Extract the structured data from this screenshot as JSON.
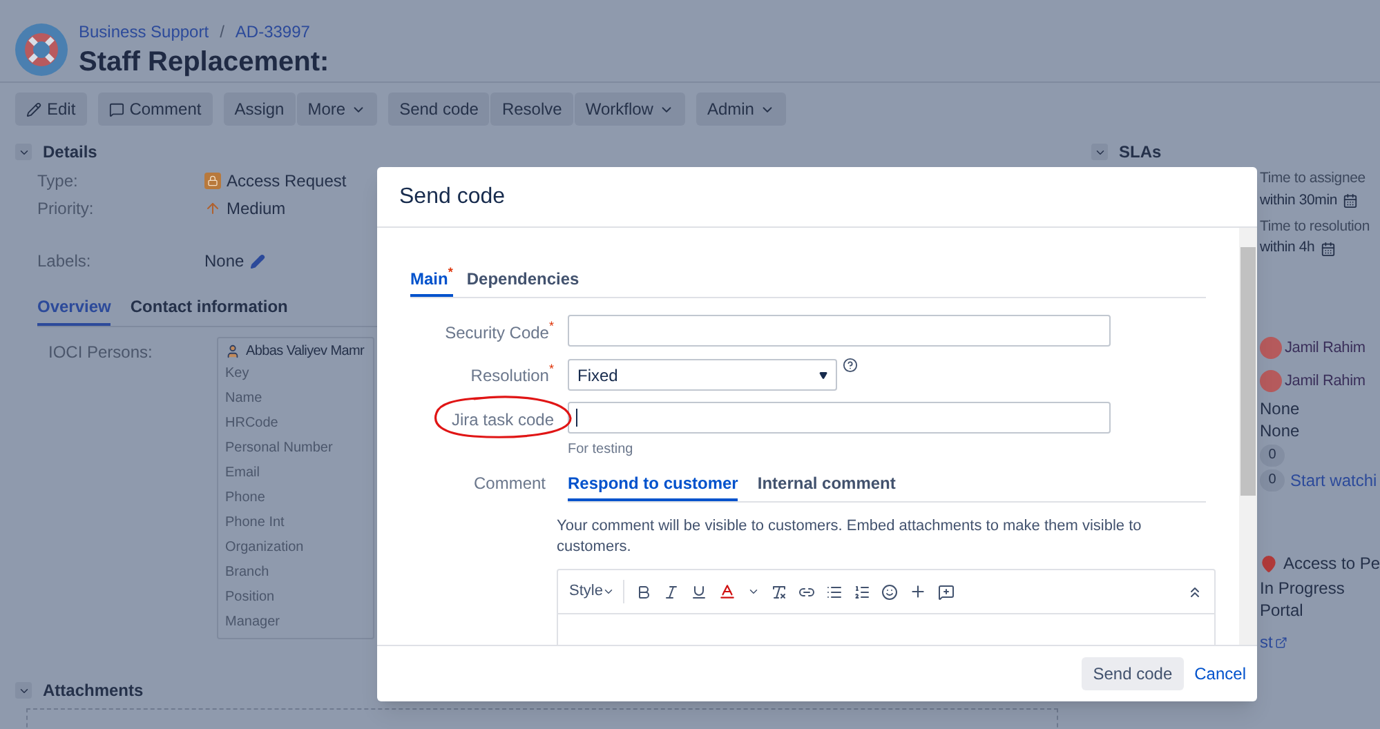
{
  "breadcrumb": {
    "project": "Business Support",
    "separator": "/",
    "key": "AD-33997"
  },
  "title": "Staff Replacement:",
  "toolbar": [
    [
      {
        "label": "Edit",
        "dropdown": false
      }
    ],
    [
      {
        "label": "Comment",
        "dropdown": false
      }
    ],
    [
      {
        "label": "Assign",
        "dropdown": false
      },
      {
        "label": "More",
        "dropdown": true
      }
    ],
    [
      {
        "label": "Send code",
        "dropdown": false
      },
      {
        "label": "Resolve",
        "dropdown": false
      },
      {
        "label": "Workflow",
        "dropdown": true
      }
    ],
    [
      {
        "label": "Admin",
        "dropdown": true
      }
    ]
  ],
  "details": {
    "heading": "Details",
    "expanded": true,
    "fields": [
      {
        "label": "Type:",
        "value": "Access Request"
      },
      {
        "label": "Priority:",
        "value": "Medium"
      },
      {
        "label": "Labels:",
        "value": "None"
      }
    ]
  },
  "detail_tabs": [
    {
      "label": "Overview",
      "selected": true
    },
    {
      "label": "Contact information",
      "selected": false
    }
  ],
  "persons": {
    "label": "IOCI Persons:",
    "name": "Abbas Valiyev Mamr",
    "fields": [
      "Key",
      "Name",
      "HRCode",
      "Personal Number",
      "Email",
      "Phone",
      "Phone Int",
      "Organization",
      "Branch",
      "Position",
      "Manager"
    ]
  },
  "attachments": {
    "heading": "Attachments",
    "expanded": true
  },
  "sidebar": {
    "heading": "SLAs",
    "expanded": true,
    "slas": [
      {
        "name": "Time to assignee",
        "value": "within 30min"
      },
      {
        "name": "Time to resolution",
        "value": "within 4h"
      }
    ],
    "people": [
      "Jamil Rahim",
      "Jamil Rahim"
    ],
    "nones": [
      "None",
      "None"
    ],
    "votes": "0",
    "watchers": "0",
    "watch_link": "Start watchi",
    "request_type": "Access to Pe",
    "status": "In Progress",
    "channel": "Portal",
    "link_fragment": "st"
  },
  "modal": {
    "title": "Send code",
    "required_mark": "*",
    "tabs": [
      {
        "label": "Main",
        "selected": true,
        "required": true
      },
      {
        "label": "Dependencies",
        "selected": false,
        "required": false
      }
    ],
    "fields": [
      {
        "kind": "text",
        "label": "Security Code",
        "required": true,
        "circled": false,
        "focused": false
      },
      {
        "kind": "select",
        "label": "Resolution",
        "required": true,
        "circled": false,
        "value": "Fixed"
      },
      {
        "kind": "text",
        "label": "Jira task code",
        "required": false,
        "circled": true,
        "focused": true,
        "hint": "For testing"
      }
    ],
    "comment": {
      "label": "Comment",
      "tabs": [
        {
          "label": "Respond to customer",
          "selected": true
        },
        {
          "label": "Internal comment",
          "selected": false
        }
      ],
      "note": "Your comment will be visible to customers. Embed attachments to make them visible to customers.",
      "style": "Style"
    },
    "buttons": [
      {
        "label": "Send code",
        "kind": "primary"
      },
      {
        "label": "Cancel",
        "kind": "link"
      }
    ]
  }
}
